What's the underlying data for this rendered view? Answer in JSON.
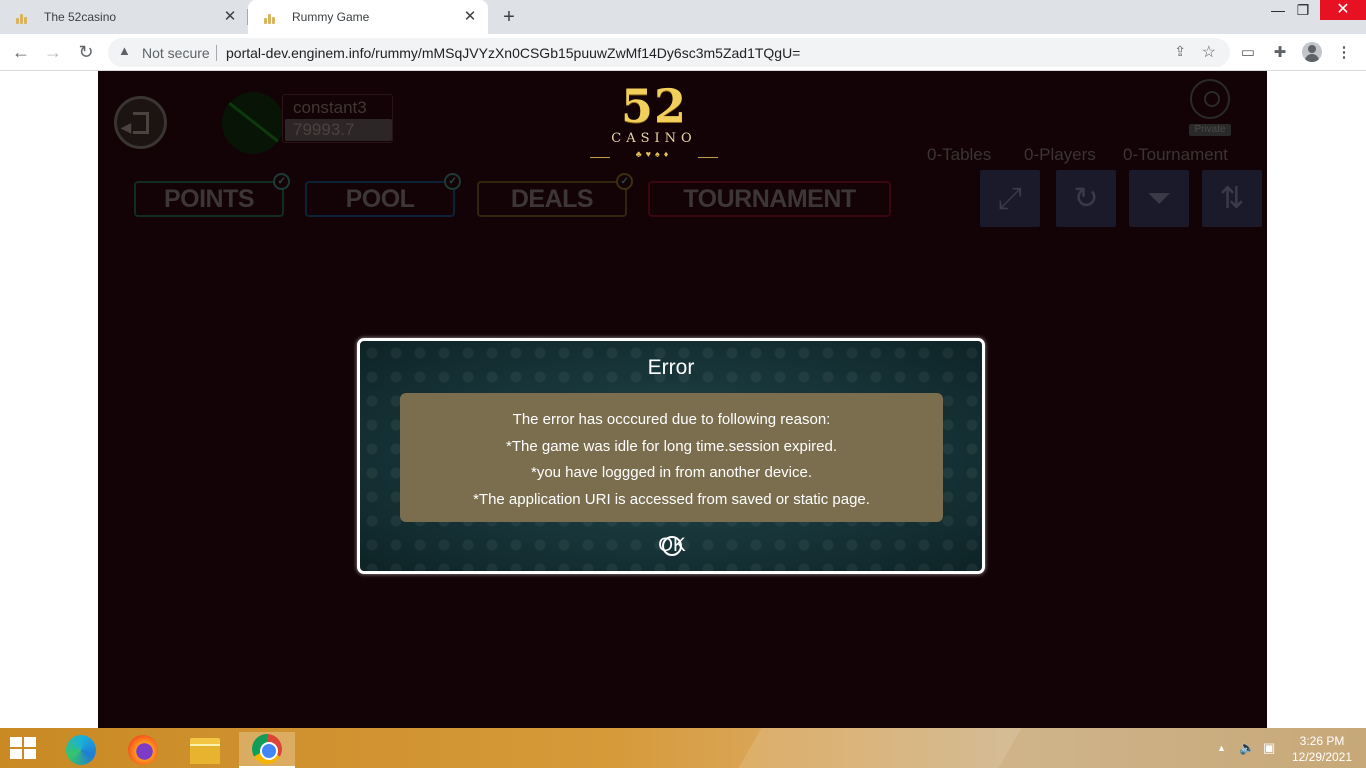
{
  "browser": {
    "tabs": [
      {
        "title": "The 52casino",
        "active": false
      },
      {
        "title": "Rummy Game",
        "active": true
      }
    ],
    "new_tab_symbol": "+",
    "security_label": "Not secure",
    "url": "portal-dev.enginem.info/rummy/mMSqJVYzXn0CSGb15puuwZwMf14Dy6sc3m5Zad1TQgU=",
    "icons": [
      "back-icon",
      "forward-icon",
      "reload-icon",
      "warning-icon",
      "share-icon",
      "star-icon",
      "media-icon",
      "extensions-icon",
      "profile-icon",
      "menu-icon"
    ]
  },
  "game": {
    "user": {
      "name": "constant3",
      "balance": "79993.7"
    },
    "logo": {
      "number": "52",
      "word": "CASINO",
      "suits": "♣♥♠♦"
    },
    "private_label": "Private",
    "stats": {
      "tables": "0-Tables",
      "players": "0-Players",
      "tournament": "0-Tournament"
    },
    "tabs": [
      {
        "label": "POINTS"
      },
      {
        "label": "POOL"
      },
      {
        "label": "DEALS"
      },
      {
        "label": "TOURNAMENT"
      }
    ],
    "tools": [
      "fullscreen-icon",
      "refresh-icon",
      "filter-icon",
      "sort-icon"
    ]
  },
  "dialog": {
    "title": "Error",
    "lines": [
      "The error has occcured due to following reason:",
      "*The game was idle for long time.session expired.",
      "*you have loggged in from another device.",
      "*The application URI is accessed from saved or static page."
    ],
    "ok_label": "OK"
  },
  "taskbar": {
    "apps": [
      "edge",
      "firefox",
      "file-explorer",
      "chrome"
    ],
    "time": "3:26 PM",
    "date": "12/29/2021"
  }
}
